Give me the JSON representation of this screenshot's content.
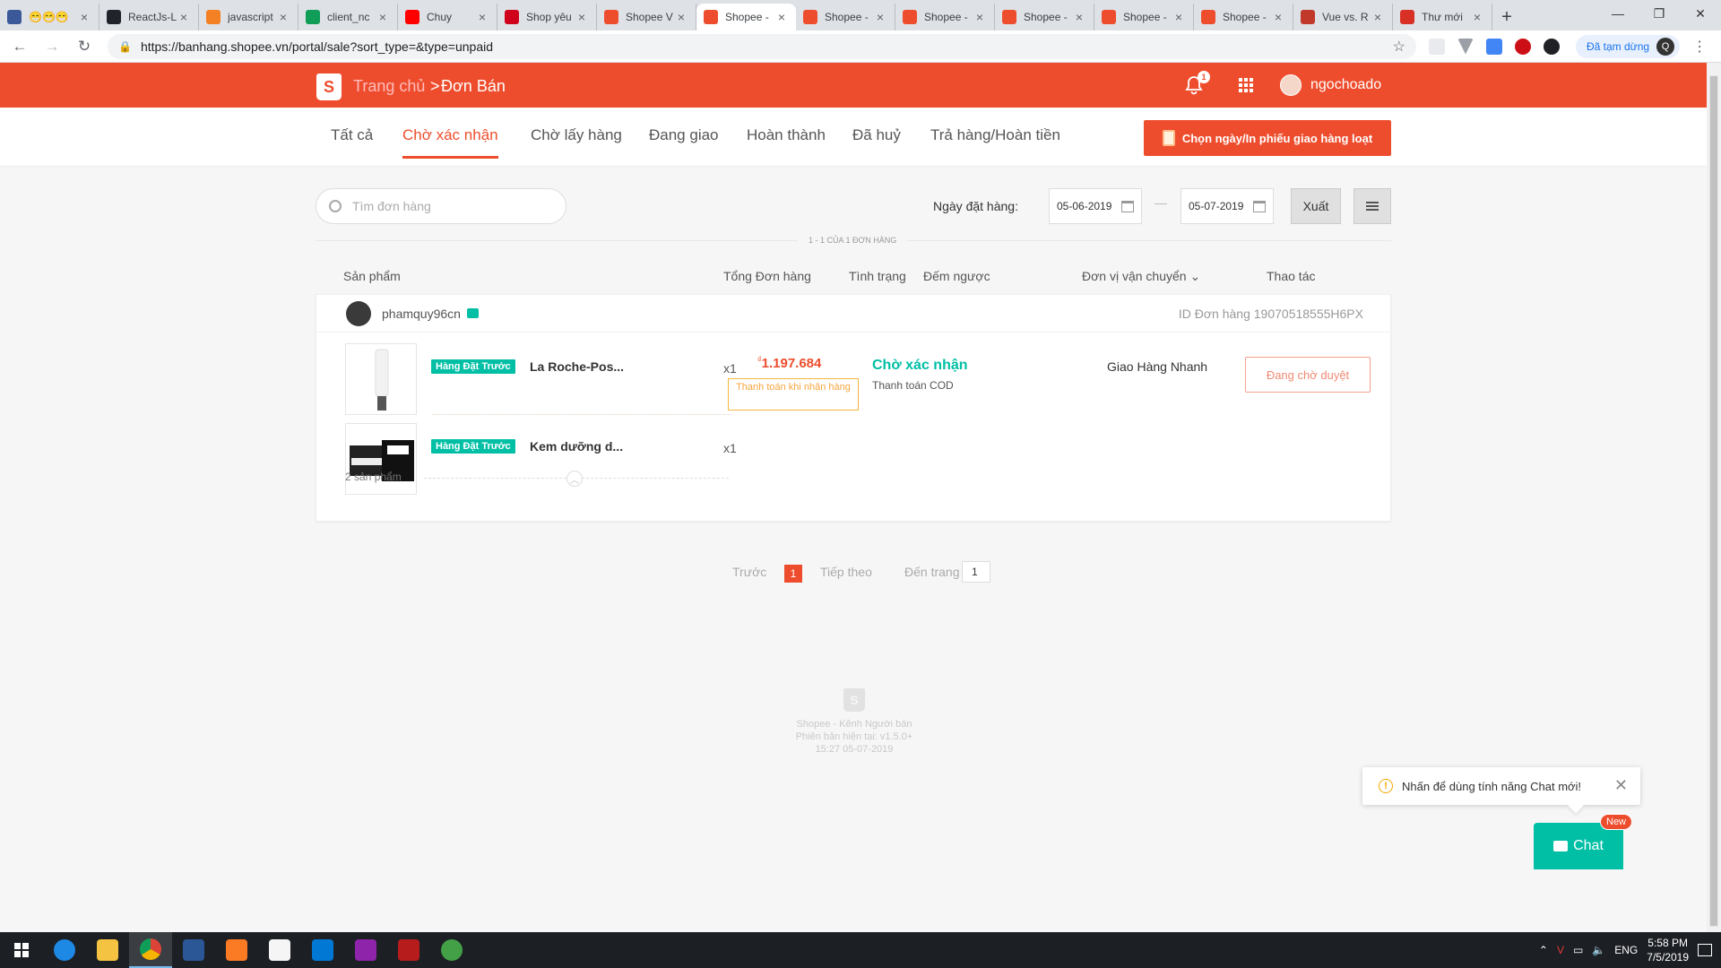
{
  "browser": {
    "tabs": [
      {
        "title": "😁😁😁",
        "favicon": "facebook-icon",
        "color": "#3b5998"
      },
      {
        "title": "ReactJs-L",
        "favicon": "react-icon",
        "color": "#20232a"
      },
      {
        "title": "javascript",
        "favicon": "stackoverflow-icon",
        "color": "#f48024"
      },
      {
        "title": "client_nc",
        "favicon": "drive-icon",
        "color": "#0f9d58"
      },
      {
        "title": "Chuy",
        "favicon": "youtube-icon",
        "color": "#ff0000"
      },
      {
        "title": "Shop yêu",
        "favicon": "shop-icon",
        "color": "#d0011b"
      },
      {
        "title": "Shopee V",
        "favicon": "shopee-icon",
        "color": "#ee4d2d"
      },
      {
        "title": "Shopee -",
        "favicon": "shopee-icon",
        "color": "#ee4d2d",
        "active": true
      },
      {
        "title": "Shopee -",
        "favicon": "shopee-icon",
        "color": "#ee4d2d"
      },
      {
        "title": "Shopee -",
        "favicon": "shopee-icon",
        "color": "#ee4d2d"
      },
      {
        "title": "Shopee -",
        "favicon": "shopee-icon",
        "color": "#ee4d2d"
      },
      {
        "title": "Shopee -",
        "favicon": "shopee-icon",
        "color": "#ee4d2d"
      },
      {
        "title": "Shopee -",
        "favicon": "shopee-icon",
        "color": "#ee4d2d"
      },
      {
        "title": "Vue vs. R",
        "favicon": "vue-icon",
        "color": "#c0392b"
      },
      {
        "title": "Thư mới",
        "favicon": "gmail-icon",
        "color": "#d93025"
      }
    ],
    "url": "https://banhang.shopee.vn/portal/sale?sort_type=&type=unpaid",
    "profile_status": "Đã tạm dừng",
    "profile_initial": "Q"
  },
  "header": {
    "home_label": "Trang chủ",
    "separator": ">",
    "current_label": "Đơn Bán",
    "notification_count": "1",
    "username": "ngochoado",
    "brand_color": "#ee4d2d"
  },
  "order_tabs": [
    {
      "label": "Tất cả"
    },
    {
      "label": "Chờ xác nhận",
      "active": true
    },
    {
      "label": "Chờ lấy hàng"
    },
    {
      "label": "Đang giao"
    },
    {
      "label": "Hoàn thành"
    },
    {
      "label": "Đã huỷ"
    },
    {
      "label": "Trả hàng/Hoàn tiền"
    }
  ],
  "bulk_print_label": "Chọn ngày/In phiếu giao hàng loạt",
  "filters": {
    "search_placeholder": "Tìm đơn hàng",
    "date_label": "Ngày đặt hàng:",
    "date_from": "05-06-2019",
    "date_to": "05-07-2019",
    "date_dash": "—",
    "export_label": "Xuất"
  },
  "result_count": "1 - 1 CỦA 1 ĐƠN HÀNG",
  "columns": {
    "product": "Sản phẩm",
    "total": "Tổng Đơn hàng",
    "status": "Tình trạng",
    "countdown": "Đếm ngược",
    "carrier": "Đơn vị vận chuyển",
    "action": "Thao tác"
  },
  "order": {
    "buyer": "phamquy96cn",
    "order_id": "ID Đơn hàng 19070518555H6PX",
    "items": [
      {
        "tag": "Hàng Đặt Trước",
        "name": "La Roche-Pos...",
        "qty": "x1"
      },
      {
        "tag": "Hàng Đặt Trước",
        "name": "Kem dưỡng d...",
        "qty": "x1"
      }
    ],
    "currency": "₫",
    "price": "1.197.684",
    "payment_badge": "Thanh toán khi nhận hàng",
    "status": "Chờ xác nhận",
    "status_sub": "Thanh toán COD",
    "carrier": "Giao Hàng Nhanh",
    "action_label": "Đang chờ duyệt",
    "product_count": "2 sản phẩm"
  },
  "pagination": {
    "prev": "Trước",
    "current": "1",
    "next": "Tiếp theo",
    "goto_label": "Đến trang",
    "goto_value": "1"
  },
  "footer": {
    "line1": "Shopee - Kênh Người bán",
    "line2": "Phiên bản hiện tại: v1.5.0+",
    "line3": "15:27 05-07-2019"
  },
  "chat": {
    "tip": "Nhấn để dùng tính năng Chat mới!",
    "button": "Chat",
    "new_badge": "New"
  },
  "taskbar": {
    "lang": "ENG",
    "time": "5:58 PM",
    "date": "7/5/2019"
  }
}
